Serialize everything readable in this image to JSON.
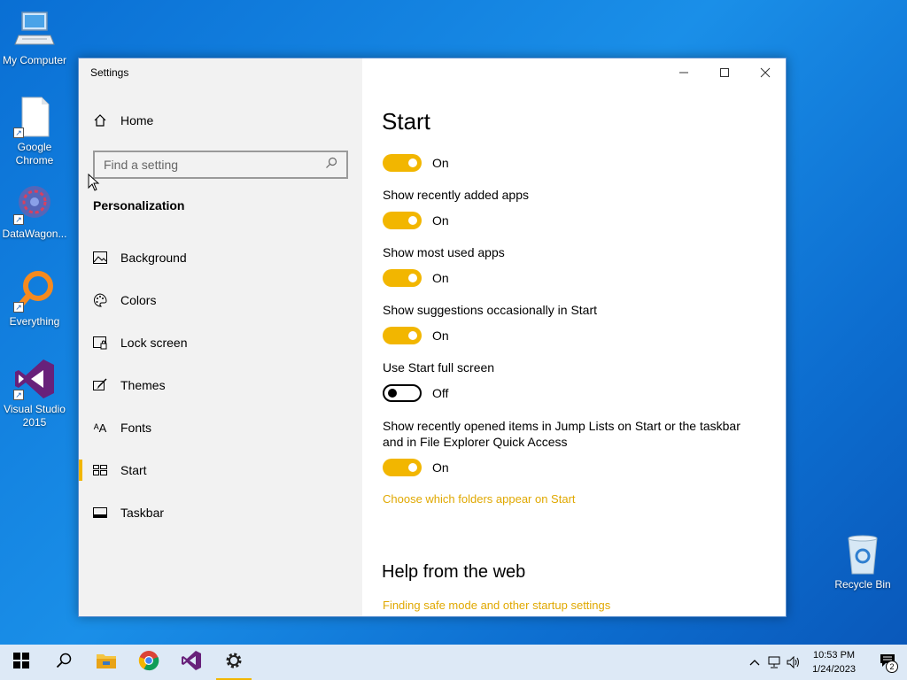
{
  "desktop": {
    "icons": [
      {
        "label": "My Computer",
        "icon": "computer-icon"
      },
      {
        "label": "Google Chrome",
        "icon": "document-shortcut-icon"
      },
      {
        "label": "DataWagon...",
        "icon": "datawagon-icon"
      },
      {
        "label": "Everything",
        "icon": "everything-search-icon"
      },
      {
        "label": "Visual Studio 2015",
        "icon": "visual-studio-icon"
      }
    ],
    "recycle_bin": "Recycle Bin"
  },
  "window": {
    "title": "Settings",
    "controls": [
      "minimize",
      "maximize",
      "close"
    ]
  },
  "sidebar": {
    "home": "Home",
    "search_placeholder": "Find a setting",
    "section": "Personalization",
    "items": [
      {
        "label": "Background",
        "icon": "picture-icon"
      },
      {
        "label": "Colors",
        "icon": "palette-icon"
      },
      {
        "label": "Lock screen",
        "icon": "lock-screen-icon"
      },
      {
        "label": "Themes",
        "icon": "themes-brush-icon"
      },
      {
        "label": "Fonts",
        "icon": "fonts-icon"
      },
      {
        "label": "Start",
        "icon": "start-grid-icon",
        "active": true
      },
      {
        "label": "Taskbar",
        "icon": "taskbar-icon"
      }
    ]
  },
  "content": {
    "title": "Start",
    "settings": [
      {
        "label": "",
        "state": "On",
        "on": true
      },
      {
        "label": "Show recently added apps",
        "state": "On",
        "on": true
      },
      {
        "label": "Show most used apps",
        "state": "On",
        "on": true
      },
      {
        "label": "Show suggestions occasionally in Start",
        "state": "On",
        "on": true
      },
      {
        "label": "Use Start full screen",
        "state": "Off",
        "on": false
      },
      {
        "label": "Show recently opened items in Jump Lists on Start or the taskbar and in File Explorer Quick Access",
        "state": "On",
        "on": true
      }
    ],
    "folders_link": "Choose which folders appear on Start",
    "help_heading": "Help from the web",
    "help_link": "Finding safe mode and other startup settings"
  },
  "taskbar": {
    "apps": [
      "start-icon",
      "search-icon",
      "file-explorer-icon",
      "chrome-icon",
      "visual-studio-icon",
      "settings-gear-icon"
    ],
    "time": "10:53 PM",
    "date": "1/24/2023",
    "notification_count": "2"
  },
  "colors": {
    "accent": "#f2b600",
    "link": "#e0a800",
    "desktop": "#0a6fd4"
  }
}
